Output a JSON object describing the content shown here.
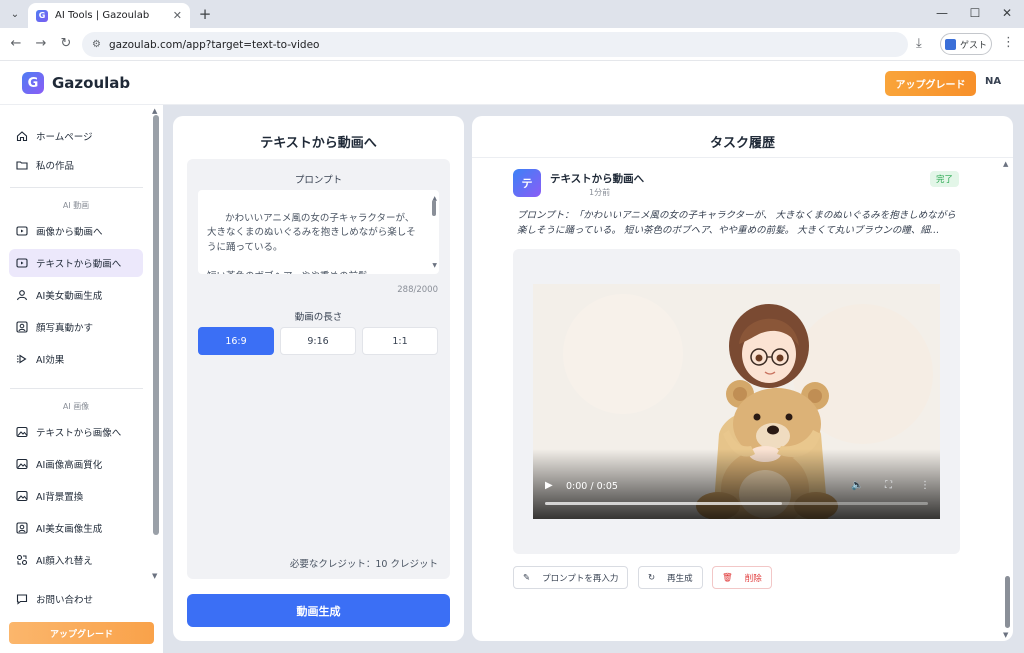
{
  "browser": {
    "tab_title": "AI Tools | Gazoulab",
    "tab_favicon": "G",
    "url": "gazoulab.com/app?target=text-to-video",
    "guest_label": "ゲスト"
  },
  "header": {
    "logo_letter": "G",
    "brand": "Gazoulab",
    "upgrade_label": "アップグレード",
    "avatar_initials": "NA"
  },
  "sidebar": {
    "items_top": [
      {
        "label": "ホームページ",
        "icon": "home-icon"
      },
      {
        "label": "私の作品",
        "icon": "folder-icon"
      }
    ],
    "section_video": "AI 動画",
    "items_video": [
      {
        "label": "画像から動画へ",
        "icon": "video-icon"
      },
      {
        "label": "テキストから動画へ",
        "icon": "video-text-icon"
      },
      {
        "label": "AI美女動画生成",
        "icon": "person-icon"
      },
      {
        "label": "顔写真動かす",
        "icon": "portrait-icon"
      },
      {
        "label": "AI効果",
        "icon": "effect-icon"
      }
    ],
    "section_image": "AI 画像",
    "items_image": [
      {
        "label": "テキストから画像へ",
        "icon": "image-icon"
      },
      {
        "label": "AI画像高画質化",
        "icon": "image-hd-icon"
      },
      {
        "label": "AI背景置換",
        "icon": "background-icon"
      },
      {
        "label": "AI美女画像生成",
        "icon": "portrait-image-icon"
      },
      {
        "label": "AI顔入れ替え",
        "icon": "face-swap-icon"
      }
    ],
    "contact_label": "お問い合わせ",
    "upgrade_label": "アップグレード"
  },
  "left_panel": {
    "title": "テキストから動画へ",
    "prompt_label": "プロンプト",
    "prompt_text": "かわいいアニメ風の女の子キャラクターが、大きなくまのぬいぐるみを抱きしめながら楽しそうに踊っている。\n\n短い茶色のボブヘア、やや重めの前髪。\n大きくて丸いブラウンの瞳、細いフレームの眼",
    "char_count": "288/2000",
    "length_label": "動画の長さ",
    "ratios": [
      "16:9",
      "9:16",
      "1:1"
    ],
    "selected_ratio": "16:9",
    "credits": "必要なクレジット：10 クレジット",
    "generate_label": "動画生成"
  },
  "right_panel": {
    "title": "タスク履歴",
    "task": {
      "icon_letter": "テ",
      "title": "テキストから動画へ",
      "time": "1分前",
      "status": "完了",
      "prompt": "プロンプト：「かわいいアニメ風の女の子キャラクターが、 大きなくまのぬいぐるみを抱きしめながら楽しそうに踊っている。 短い茶色のボブヘア、やや重めの前髪。 大きくて丸いブラウンの瞳、細…",
      "video_time": "0:00 / 0:05",
      "video_progress": 0
    },
    "actions": {
      "reprompt": "プロンプトを再入力",
      "regenerate": "再生成",
      "delete": "削除"
    }
  },
  "colors": {
    "accent": "#3b6ff5",
    "upgrade": "#f7902a",
    "success": "#22a54a",
    "danger": "#e03b3b"
  }
}
